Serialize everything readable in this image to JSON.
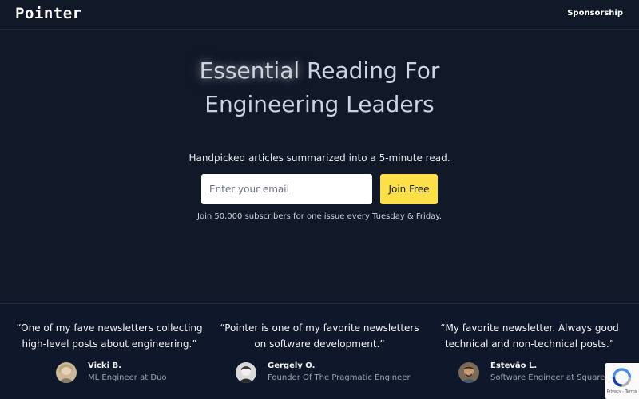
{
  "header": {
    "logo": "Pointer",
    "nav_sponsorship": "Sponsorship"
  },
  "hero": {
    "title_highlight": "Essential",
    "title_rest_line1": " Reading For",
    "title_line2": "Engineering Leaders",
    "tagline": "Handpicked articles summarized into a 5-minute read.",
    "email_placeholder": "Enter your email",
    "join_label": "Join Free",
    "subscribers_text": "Join 50,000 subscribers for one issue every Tuesday & Friday."
  },
  "testimonials": [
    {
      "quote": "“One of my fave newsletters collecting high-level posts about engineering.”",
      "name": "Vicki B.",
      "role": "ML Engineer at Duo"
    },
    {
      "quote": "“Pointer is one of my favorite newsletters on software development.”",
      "name": "Gergely O.",
      "role": "Founder Of The Pragmatic Engineer"
    },
    {
      "quote": "“My favorite newsletter. Always good technical and non-technical posts.”",
      "name": "Estevão L.",
      "role": "Software Engineer at Square"
    }
  ],
  "recaptcha": {
    "links": "Privacy - Terms"
  },
  "colors": {
    "background": "#111827",
    "accent_button": "#fde047",
    "testimonials_bg": "#0f172a"
  }
}
